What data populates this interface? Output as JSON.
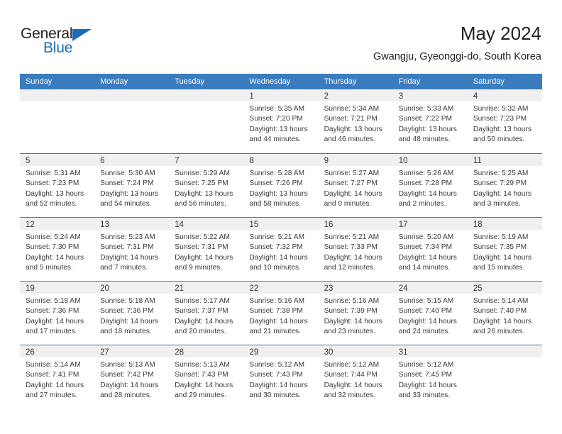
{
  "brand": {
    "name_part1": "General",
    "name_part2": "Blue",
    "triangle_icon": "triangle-icon",
    "colors": {
      "blue": "#1c6cb5",
      "dark": "#231f20"
    }
  },
  "header": {
    "title": "May 2024",
    "subtitle": "Gwangju, Gyeonggi-do, South Korea"
  },
  "calendar": {
    "accent_color": "#3a7cbe",
    "day_strip_color": "#f0f0f0",
    "day_headers": [
      "Sunday",
      "Monday",
      "Tuesday",
      "Wednesday",
      "Thursday",
      "Friday",
      "Saturday"
    ],
    "weeks": [
      [
        {
          "day": "",
          "empty": true,
          "lines": []
        },
        {
          "day": "",
          "empty": true,
          "lines": []
        },
        {
          "day": "",
          "empty": true,
          "lines": []
        },
        {
          "day": "1",
          "empty": false,
          "lines": [
            "Sunrise: 5:35 AM",
            "Sunset: 7:20 PM",
            "Daylight: 13 hours",
            "and 44 minutes."
          ]
        },
        {
          "day": "2",
          "empty": false,
          "lines": [
            "Sunrise: 5:34 AM",
            "Sunset: 7:21 PM",
            "Daylight: 13 hours",
            "and 46 minutes."
          ]
        },
        {
          "day": "3",
          "empty": false,
          "lines": [
            "Sunrise: 5:33 AM",
            "Sunset: 7:22 PM",
            "Daylight: 13 hours",
            "and 48 minutes."
          ]
        },
        {
          "day": "4",
          "empty": false,
          "lines": [
            "Sunrise: 5:32 AM",
            "Sunset: 7:23 PM",
            "Daylight: 13 hours",
            "and 50 minutes."
          ]
        }
      ],
      [
        {
          "day": "5",
          "empty": false,
          "lines": [
            "Sunrise: 5:31 AM",
            "Sunset: 7:23 PM",
            "Daylight: 13 hours",
            "and 52 minutes."
          ]
        },
        {
          "day": "6",
          "empty": false,
          "lines": [
            "Sunrise: 5:30 AM",
            "Sunset: 7:24 PM",
            "Daylight: 13 hours",
            "and 54 minutes."
          ]
        },
        {
          "day": "7",
          "empty": false,
          "lines": [
            "Sunrise: 5:29 AM",
            "Sunset: 7:25 PM",
            "Daylight: 13 hours",
            "and 56 minutes."
          ]
        },
        {
          "day": "8",
          "empty": false,
          "lines": [
            "Sunrise: 5:28 AM",
            "Sunset: 7:26 PM",
            "Daylight: 13 hours",
            "and 58 minutes."
          ]
        },
        {
          "day": "9",
          "empty": false,
          "lines": [
            "Sunrise: 5:27 AM",
            "Sunset: 7:27 PM",
            "Daylight: 14 hours",
            "and 0 minutes."
          ]
        },
        {
          "day": "10",
          "empty": false,
          "lines": [
            "Sunrise: 5:26 AM",
            "Sunset: 7:28 PM",
            "Daylight: 14 hours",
            "and 2 minutes."
          ]
        },
        {
          "day": "11",
          "empty": false,
          "lines": [
            "Sunrise: 5:25 AM",
            "Sunset: 7:29 PM",
            "Daylight: 14 hours",
            "and 3 minutes."
          ]
        }
      ],
      [
        {
          "day": "12",
          "empty": false,
          "lines": [
            "Sunrise: 5:24 AM",
            "Sunset: 7:30 PM",
            "Daylight: 14 hours",
            "and 5 minutes."
          ]
        },
        {
          "day": "13",
          "empty": false,
          "lines": [
            "Sunrise: 5:23 AM",
            "Sunset: 7:31 PM",
            "Daylight: 14 hours",
            "and 7 minutes."
          ]
        },
        {
          "day": "14",
          "empty": false,
          "lines": [
            "Sunrise: 5:22 AM",
            "Sunset: 7:31 PM",
            "Daylight: 14 hours",
            "and 9 minutes."
          ]
        },
        {
          "day": "15",
          "empty": false,
          "lines": [
            "Sunrise: 5:21 AM",
            "Sunset: 7:32 PM",
            "Daylight: 14 hours",
            "and 10 minutes."
          ]
        },
        {
          "day": "16",
          "empty": false,
          "lines": [
            "Sunrise: 5:21 AM",
            "Sunset: 7:33 PM",
            "Daylight: 14 hours",
            "and 12 minutes."
          ]
        },
        {
          "day": "17",
          "empty": false,
          "lines": [
            "Sunrise: 5:20 AM",
            "Sunset: 7:34 PM",
            "Daylight: 14 hours",
            "and 14 minutes."
          ]
        },
        {
          "day": "18",
          "empty": false,
          "lines": [
            "Sunrise: 5:19 AM",
            "Sunset: 7:35 PM",
            "Daylight: 14 hours",
            "and 15 minutes."
          ]
        }
      ],
      [
        {
          "day": "19",
          "empty": false,
          "lines": [
            "Sunrise: 5:18 AM",
            "Sunset: 7:36 PM",
            "Daylight: 14 hours",
            "and 17 minutes."
          ]
        },
        {
          "day": "20",
          "empty": false,
          "lines": [
            "Sunrise: 5:18 AM",
            "Sunset: 7:36 PM",
            "Daylight: 14 hours",
            "and 18 minutes."
          ]
        },
        {
          "day": "21",
          "empty": false,
          "lines": [
            "Sunrise: 5:17 AM",
            "Sunset: 7:37 PM",
            "Daylight: 14 hours",
            "and 20 minutes."
          ]
        },
        {
          "day": "22",
          "empty": false,
          "lines": [
            "Sunrise: 5:16 AM",
            "Sunset: 7:38 PM",
            "Daylight: 14 hours",
            "and 21 minutes."
          ]
        },
        {
          "day": "23",
          "empty": false,
          "lines": [
            "Sunrise: 5:16 AM",
            "Sunset: 7:39 PM",
            "Daylight: 14 hours",
            "and 23 minutes."
          ]
        },
        {
          "day": "24",
          "empty": false,
          "lines": [
            "Sunrise: 5:15 AM",
            "Sunset: 7:40 PM",
            "Daylight: 14 hours",
            "and 24 minutes."
          ]
        },
        {
          "day": "25",
          "empty": false,
          "lines": [
            "Sunrise: 5:14 AM",
            "Sunset: 7:40 PM",
            "Daylight: 14 hours",
            "and 26 minutes."
          ]
        }
      ],
      [
        {
          "day": "26",
          "empty": false,
          "lines": [
            "Sunrise: 5:14 AM",
            "Sunset: 7:41 PM",
            "Daylight: 14 hours",
            "and 27 minutes."
          ]
        },
        {
          "day": "27",
          "empty": false,
          "lines": [
            "Sunrise: 5:13 AM",
            "Sunset: 7:42 PM",
            "Daylight: 14 hours",
            "and 28 minutes."
          ]
        },
        {
          "day": "28",
          "empty": false,
          "lines": [
            "Sunrise: 5:13 AM",
            "Sunset: 7:43 PM",
            "Daylight: 14 hours",
            "and 29 minutes."
          ]
        },
        {
          "day": "29",
          "empty": false,
          "lines": [
            "Sunrise: 5:12 AM",
            "Sunset: 7:43 PM",
            "Daylight: 14 hours",
            "and 30 minutes."
          ]
        },
        {
          "day": "30",
          "empty": false,
          "lines": [
            "Sunrise: 5:12 AM",
            "Sunset: 7:44 PM",
            "Daylight: 14 hours",
            "and 32 minutes."
          ]
        },
        {
          "day": "31",
          "empty": false,
          "lines": [
            "Sunrise: 5:12 AM",
            "Sunset: 7:45 PM",
            "Daylight: 14 hours",
            "and 33 minutes."
          ]
        },
        {
          "day": "",
          "empty": true,
          "lines": []
        }
      ]
    ]
  }
}
